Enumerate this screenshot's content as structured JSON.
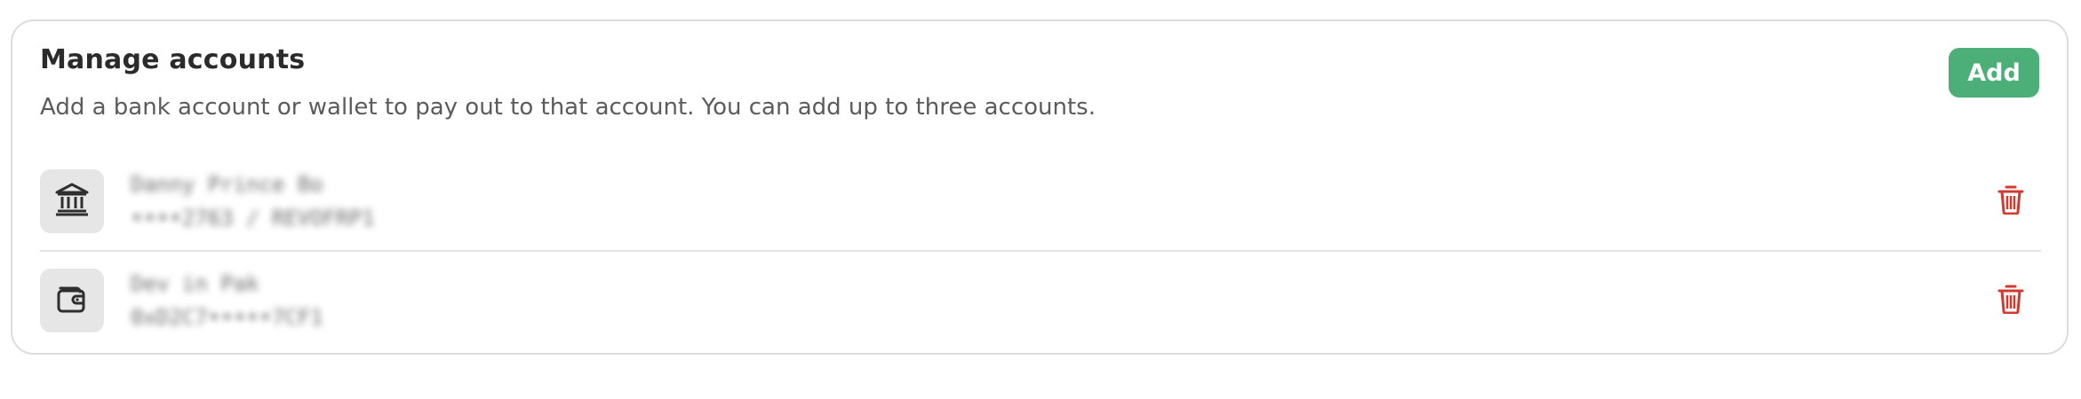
{
  "header": {
    "title": "Manage accounts",
    "subtitle": "Add a bank account or wallet to pay out to that account. You can add up to three accounts.",
    "add_label": "Add"
  },
  "accounts": [
    {
      "name": "Danny Prince Bo",
      "detail": "••••2763 / REVOFRP1",
      "icon": "bank-icon"
    },
    {
      "name": "Dev in Pak",
      "detail": "0xD2C7•••••7CF1",
      "icon": "wallet-icon"
    }
  ],
  "colors": {
    "accent": "#4caf78",
    "danger": "#d2392f"
  }
}
